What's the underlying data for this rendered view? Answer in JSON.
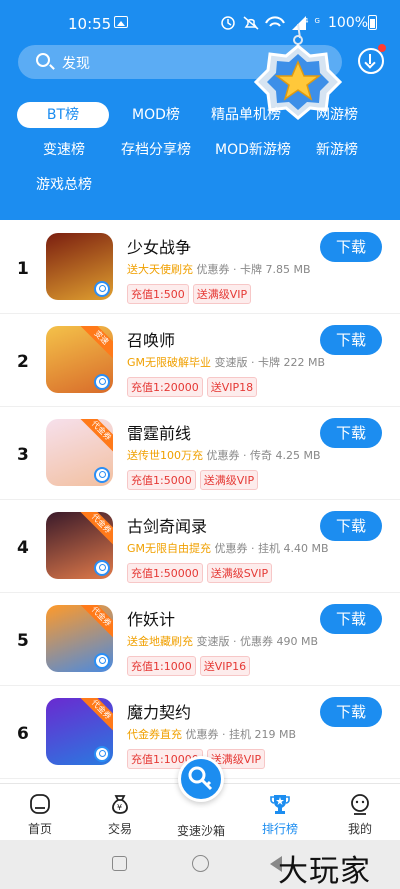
{
  "status_bar": {
    "time": "10:55",
    "battery": "100%",
    "network": "4G"
  },
  "search": {
    "placeholder": "发现"
  },
  "tabs": [
    {
      "label": "BT榜",
      "active": true
    },
    {
      "label": "MOD榜"
    },
    {
      "label": "精品单机榜"
    },
    {
      "label": "网游榜"
    },
    {
      "label": "变速榜"
    },
    {
      "label": "存档分享榜"
    },
    {
      "label": "MOD新游榜"
    },
    {
      "label": "新游榜"
    },
    {
      "label": "游戏总榜"
    }
  ],
  "download_label": "下载",
  "apps": [
    {
      "rank": "1",
      "name": "少女战争",
      "promo": "送大天使刷充",
      "meta": " 优惠券 · 卡牌 7.85 MB",
      "chips": [
        "充值1:500",
        "送满级VIP"
      ],
      "icon_tag": "",
      "icon_colors": [
        "#7a1e10",
        "#e0a030"
      ]
    },
    {
      "rank": "2",
      "name": "召唤师",
      "promo": "GM无限破解毕业",
      "meta": " 变速版 · 卡牌 222 MB",
      "chips": [
        "充值1:20000",
        "送VIP18"
      ],
      "icon_tag": "变速",
      "icon_colors": [
        "#f4c24a",
        "#d86b2a"
      ]
    },
    {
      "rank": "3",
      "name": "雷霆前线",
      "promo": "送传世100万充",
      "meta": " 优惠券 · 传奇 4.25 MB",
      "chips": [
        "充值1:5000",
        "送满级VIP"
      ],
      "icon_tag": "代金券",
      "icon_colors": [
        "#f6e0ec",
        "#f2c0a0"
      ]
    },
    {
      "rank": "4",
      "name": "古剑奇闻录",
      "promo": "GM无限自由提充",
      "meta": " 优惠券 · 挂机 4.40 MB",
      "chips": [
        "充值1:50000",
        "送满级SVIP"
      ],
      "icon_tag": "代金券",
      "icon_colors": [
        "#3a1a2a",
        "#e07a4a"
      ]
    },
    {
      "rank": "5",
      "name": "作妖计",
      "promo": "送金地藏刷充",
      "meta": " 变速版 · 优惠券 490 MB",
      "chips": [
        "充值1:1000",
        "送VIP16"
      ],
      "icon_tag": "代金券",
      "icon_colors": [
        "#ff9a2a",
        "#4a8ae0"
      ]
    },
    {
      "rank": "6",
      "name": "魔力契约",
      "promo": "代金券直充",
      "meta": " 优惠券 · 挂机 219 MB",
      "chips": [
        "充值1:10000",
        "送满级VIP"
      ],
      "icon_tag": "代金券",
      "icon_colors": [
        "#6a2ad0",
        "#2a7ae0"
      ]
    }
  ],
  "bottom_nav": [
    {
      "label": "首页"
    },
    {
      "label": "交易"
    },
    {
      "label": "变速沙箱"
    },
    {
      "label": "排行榜",
      "active": true
    },
    {
      "label": "我的"
    }
  ],
  "watermark": "大玩家",
  "colors": {
    "primary": "#1c8df0",
    "promo": "#f0a000",
    "chip": "#e53935"
  }
}
